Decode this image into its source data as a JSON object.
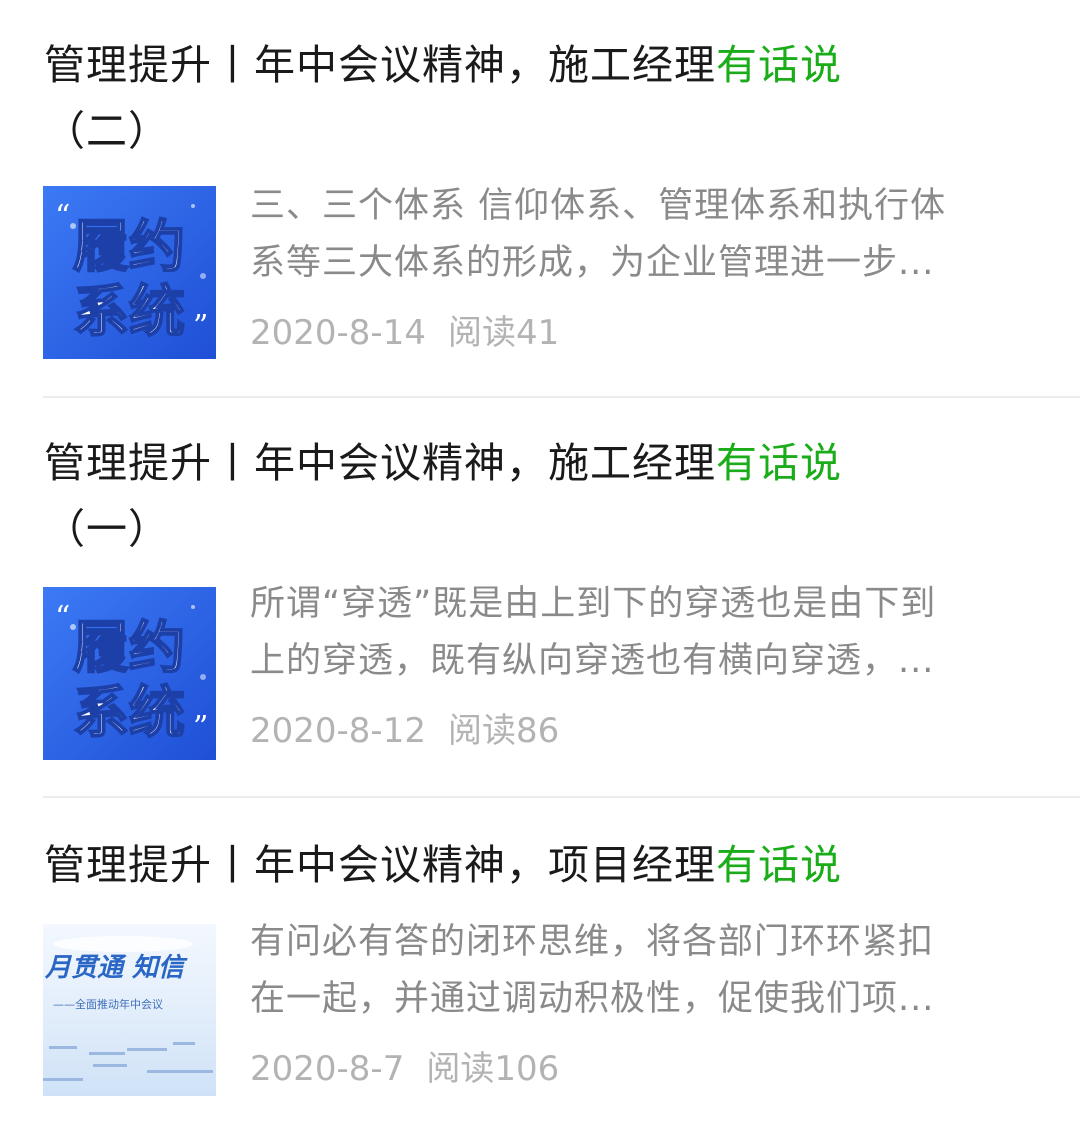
{
  "articles": [
    {
      "title_prefix": "管理提升丨年中会议精神，施工经理",
      "title_highlight": "有话说",
      "title_suffix": "（二）",
      "digest_line1": "三、三个体系 信仰体系、管理体系和执行体",
      "digest_line2": "系等三大体系的形成，为企业管理进一步...",
      "date": "2020-8-14",
      "reads": "阅读41",
      "thumb_text_line1": "履约",
      "thumb_text_line2": "系统"
    },
    {
      "title_prefix": "管理提升丨年中会议精神，施工经理",
      "title_highlight": "有话说",
      "title_suffix": "（一）",
      "digest_line1": "所谓“穿透”既是由上到下的穿透也是由下到",
      "digest_line2": "上的穿透，既有纵向穿透也有横向穿透，...",
      "date": "2020-8-12",
      "reads": "阅读86",
      "thumb_text_line1": "履约",
      "thumb_text_line2": "系统"
    },
    {
      "title_prefix": "管理提升丨年中会议精神，项目经理",
      "title_highlight": "有话说",
      "digest_line1": "有问必有答的闭环思维，将各部门环环紧扣",
      "digest_line2": "在一起，并通过调动积极性，促使我们项...",
      "date": "2020-8-7",
      "reads": "阅读106",
      "thumb_text_line1": "月贯通 知信",
      "thumb_text_line2": "——全面推动年中会议"
    }
  ],
  "colors": {
    "highlight": "#1aad19",
    "title": "#1a1a1a",
    "digest": "#8a8a8a",
    "meta": "#b3b3b3",
    "thumb_blue": "#2f6cf0"
  }
}
